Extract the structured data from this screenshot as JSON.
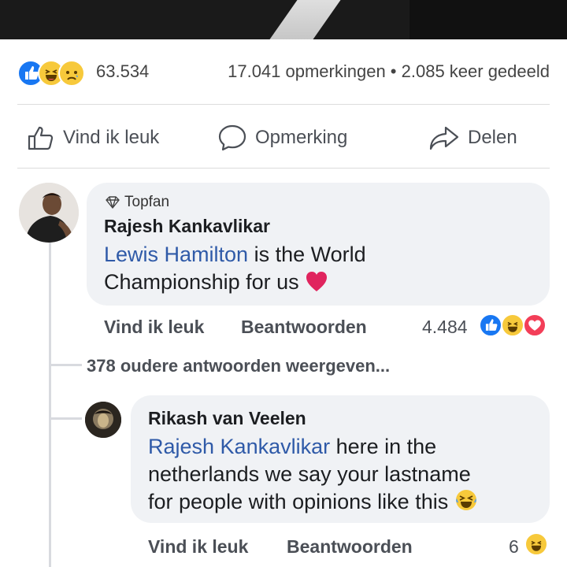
{
  "post": {
    "reaction_count": "63.534",
    "comments_shares": "17.041 opmerkingen • 2.085 keer gedeeld",
    "reaction_icons": [
      "like-icon",
      "haha-icon",
      "sad-icon"
    ]
  },
  "actions": {
    "like": "Vind ik leuk",
    "comment": "Opmerking",
    "share": "Delen"
  },
  "comments": [
    {
      "badge": "Topfan",
      "author": "Rajesh Kankavlikar",
      "mention": "Lewis Hamilton",
      "text_line1": " is the World",
      "text_line2": "Championship for us",
      "emoji": "heart-icon",
      "like_label": "Vind ik leuk",
      "reply_label": "Beantwoorden",
      "reaction_count": "4.484",
      "reaction_icons": [
        "like-icon",
        "haha-icon",
        "love-icon"
      ]
    }
  ],
  "older_replies": "378 oudere antwoorden weergeven...",
  "replies": [
    {
      "author": "Rikash van Veelen",
      "mention": "Rajesh Kankavlikar",
      "text_line1": " here in the",
      "text_line2": "netherlands we say your lastname",
      "text_line3": "for people with opinions like this",
      "emoji": "laughing-crying-icon",
      "like_label": "Vind ik leuk",
      "reply_label": "Beantwoorden",
      "reaction_count": "6",
      "reaction_icons": [
        "haha-icon"
      ]
    }
  ],
  "colors": {
    "like_blue": "#1877f2",
    "mention_blue": "#2f5aa8",
    "bubble_bg": "#f0f2f5",
    "heart_red": "#e0245e",
    "haha_yellow": "#f7c93b"
  }
}
